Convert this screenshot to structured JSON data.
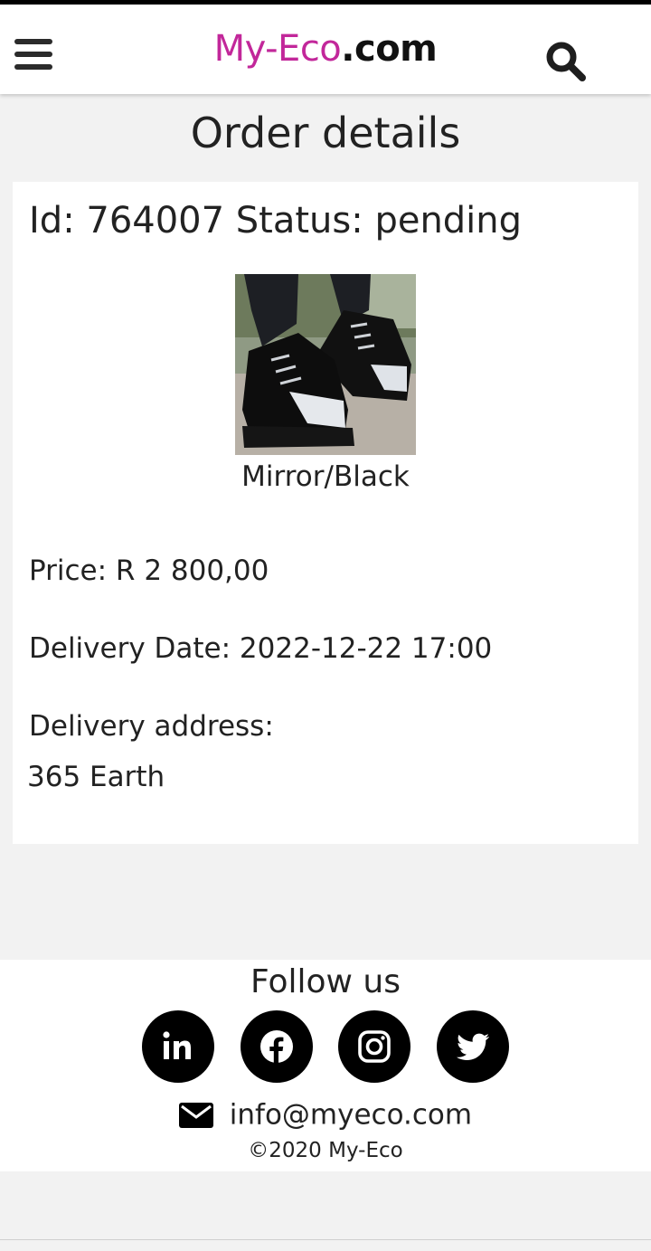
{
  "header": {
    "logo_brand": "My-Eco",
    "logo_tld": ".com",
    "menu_icon": "hamburger-menu-icon",
    "search_icon": "search-icon"
  },
  "page": {
    "title": "Order details"
  },
  "order": {
    "heading": "Id: 764007 Status: pending",
    "image_alt": "Black sneaker with mirror toe cap",
    "variant": "Mirror/Black",
    "price_line": "Price: R 2 800,00",
    "delivery_date_line": "Delivery Date: 2022-12-22 17:00",
    "delivery_address_label": "Delivery address:",
    "delivery_address": "365 Earth"
  },
  "footer": {
    "follow_label": "Follow us",
    "social": [
      {
        "name": "linkedin-icon"
      },
      {
        "name": "facebook-icon"
      },
      {
        "name": "instagram-icon"
      },
      {
        "name": "twitter-icon"
      }
    ],
    "email": "info@myeco.com",
    "copyright": "©2020 My-Eco"
  },
  "colors": {
    "brand": "#c2279a",
    "background": "#f2f2f2",
    "card": "#ffffff",
    "text": "#222222"
  }
}
